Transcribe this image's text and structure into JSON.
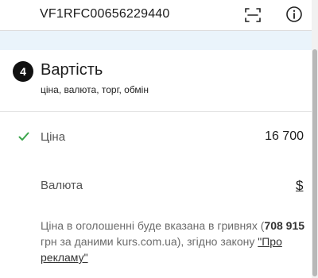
{
  "header": {
    "vin": "VF1RFC00656229440",
    "scan_icon": "scan-icon",
    "info_icon": "info-icon"
  },
  "section": {
    "step": "4",
    "title": "Вартість",
    "subtitle": "ціна, валюта, торг, обмін"
  },
  "price": {
    "label": "Ціна",
    "value": "16 700",
    "status_icon": "check-icon",
    "status_color": "#3aa54b"
  },
  "currency": {
    "label": "Валюта",
    "value": "$"
  },
  "note": {
    "text_before": "Ціна в оголошенні буде вказана в гривнях (",
    "uah_amount": "708 915",
    "text_middle": " грн за даними kurs.com.ua), згідно закону ",
    "law_link": "\"Про рекламу\""
  }
}
